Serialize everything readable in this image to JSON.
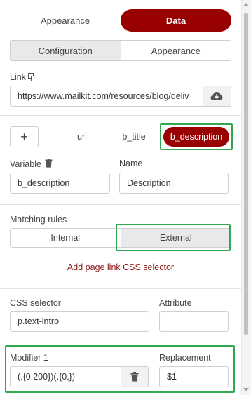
{
  "top_tabs": [
    {
      "label": "Appearance",
      "active": false
    },
    {
      "label": "Data",
      "active": true
    }
  ],
  "sub_tabs": [
    {
      "label": "Configuration",
      "active": true
    },
    {
      "label": "Appearance",
      "active": false
    }
  ],
  "link": {
    "label": "Link",
    "value": "https://www.mailkit.com/resources/blog/deliv"
  },
  "variables": {
    "add_label": "+",
    "chips": [
      {
        "label": "url",
        "active": false
      },
      {
        "label": "b_title",
        "active": false
      },
      {
        "label": "b_description",
        "active": true
      }
    ]
  },
  "variable_field": {
    "label": "Variable",
    "value": "b_description"
  },
  "name_field": {
    "label": "Name",
    "value": "Description"
  },
  "matching_rules": {
    "label": "Matching rules",
    "options": [
      {
        "label": "Internal",
        "active": false
      },
      {
        "label": "External",
        "active": true
      }
    ]
  },
  "add_selector_link": "Add page link CSS selector",
  "css_selector": {
    "label": "CSS selector",
    "value": "p.text-intro"
  },
  "attribute": {
    "label": "Attribute",
    "value": ""
  },
  "modifier": {
    "label": "Modifier 1",
    "value": "(.{0,200})(.{0,})"
  },
  "replacement": {
    "label": "Replacement",
    "value": "$1"
  },
  "colors": {
    "accent": "#990000",
    "highlight": "#2fa84f"
  }
}
